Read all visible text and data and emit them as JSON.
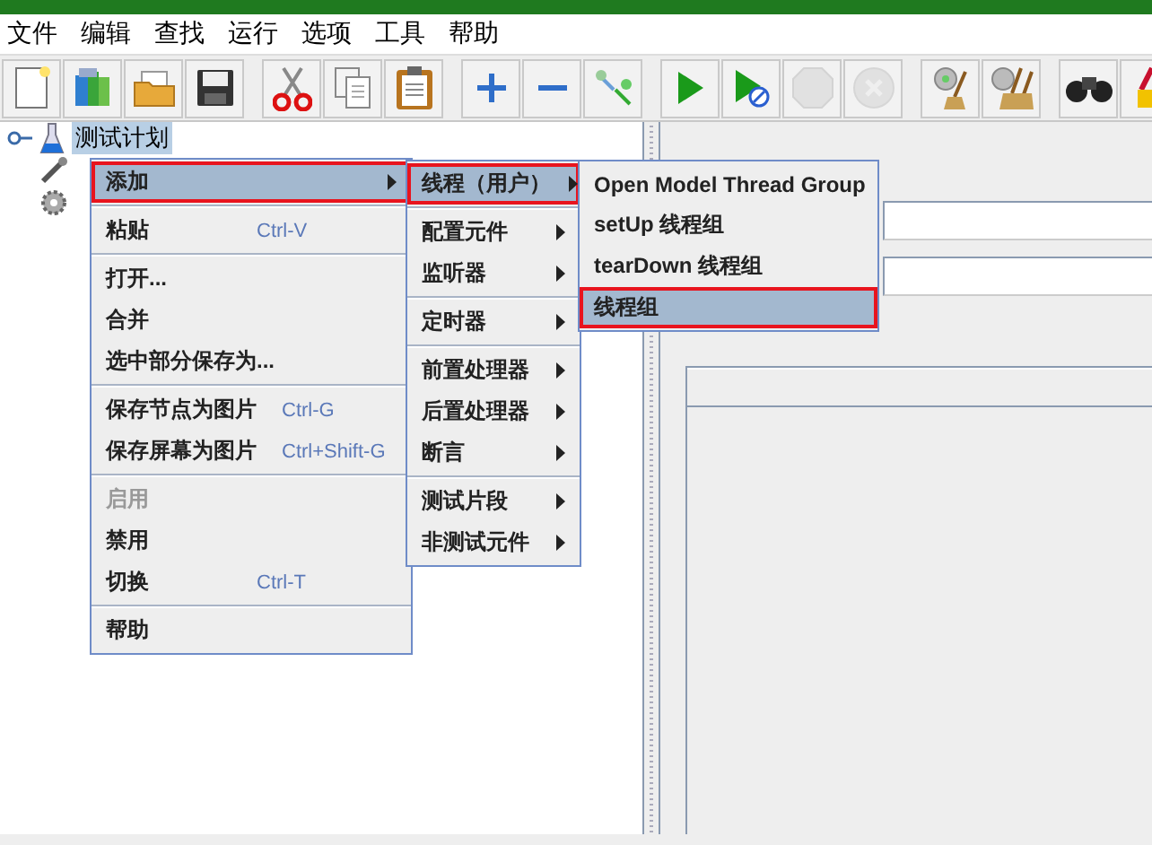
{
  "menubar": [
    "文件",
    "编辑",
    "查找",
    "运行",
    "选项",
    "工具",
    "帮助"
  ],
  "toolbar": [
    {
      "kind": "new",
      "disabled": false
    },
    {
      "kind": "templates",
      "disabled": false
    },
    {
      "kind": "open",
      "disabled": false
    },
    {
      "kind": "save",
      "disabled": false
    },
    {
      "kind": "sep"
    },
    {
      "kind": "cut",
      "disabled": false
    },
    {
      "kind": "copy",
      "disabled": false
    },
    {
      "kind": "paste",
      "disabled": false
    },
    {
      "kind": "sep"
    },
    {
      "kind": "expand",
      "disabled": false
    },
    {
      "kind": "collapse",
      "disabled": false
    },
    {
      "kind": "toggle",
      "disabled": false
    },
    {
      "kind": "sep"
    },
    {
      "kind": "start",
      "disabled": false
    },
    {
      "kind": "start-no-timers",
      "disabled": false
    },
    {
      "kind": "stop",
      "disabled": true
    },
    {
      "kind": "shutdown",
      "disabled": true
    },
    {
      "kind": "sep"
    },
    {
      "kind": "clear",
      "disabled": false
    },
    {
      "kind": "clear-all",
      "disabled": false
    },
    {
      "kind": "sep"
    },
    {
      "kind": "search",
      "disabled": false
    },
    {
      "kind": "broom",
      "disabled": false
    }
  ],
  "tree": {
    "label": "测试计划",
    "selected": true,
    "expanded": true,
    "children": [
      {
        "kind": "tool"
      },
      {
        "kind": "gear"
      }
    ]
  },
  "menus": [
    {
      "items": [
        {
          "kind": "item",
          "label": "添加",
          "submenu": true,
          "selected": true,
          "disabled": false,
          "outlined": true
        },
        {
          "kind": "separator"
        },
        {
          "kind": "item",
          "label": "粘贴",
          "shortcut": "Ctrl-V",
          "submenu": false,
          "selected": false,
          "disabled": false,
          "outlined": false
        },
        {
          "kind": "separator"
        },
        {
          "kind": "item",
          "label": "打开...",
          "submenu": false,
          "selected": false,
          "disabled": false,
          "outlined": false
        },
        {
          "kind": "item",
          "label": "合并",
          "submenu": false,
          "selected": false,
          "disabled": false,
          "outlined": false
        },
        {
          "kind": "item",
          "label": "选中部分保存为...",
          "submenu": false,
          "selected": false,
          "disabled": false,
          "outlined": false
        },
        {
          "kind": "separator"
        },
        {
          "kind": "item",
          "label": "保存节点为图片",
          "shortcut": "Ctrl-G",
          "submenu": false,
          "selected": false,
          "disabled": false,
          "outlined": false
        },
        {
          "kind": "item",
          "label": "保存屏幕为图片",
          "shortcut": "Ctrl+Shift-G",
          "submenu": false,
          "selected": false,
          "disabled": false,
          "outlined": false
        },
        {
          "kind": "separator"
        },
        {
          "kind": "item",
          "label": "启用",
          "submenu": false,
          "selected": false,
          "disabled": true,
          "outlined": false
        },
        {
          "kind": "item",
          "label": "禁用",
          "submenu": false,
          "selected": false,
          "disabled": false,
          "outlined": false
        },
        {
          "kind": "item",
          "label": "切换",
          "shortcut": "Ctrl-T",
          "submenu": false,
          "selected": false,
          "disabled": false,
          "outlined": false
        },
        {
          "kind": "separator"
        },
        {
          "kind": "item",
          "label": "帮助",
          "submenu": false,
          "selected": false,
          "disabled": false,
          "outlined": false
        }
      ]
    },
    {
      "items": [
        {
          "kind": "item",
          "label": "线程（用户）",
          "submenu": true,
          "selected": true,
          "disabled": false,
          "outlined": true
        },
        {
          "kind": "separator"
        },
        {
          "kind": "item",
          "label": "配置元件",
          "submenu": true,
          "selected": false,
          "disabled": false,
          "outlined": false
        },
        {
          "kind": "item",
          "label": "监听器",
          "submenu": true,
          "selected": false,
          "disabled": false,
          "outlined": false
        },
        {
          "kind": "separator"
        },
        {
          "kind": "item",
          "label": "定时器",
          "submenu": true,
          "selected": false,
          "disabled": false,
          "outlined": false
        },
        {
          "kind": "separator"
        },
        {
          "kind": "item",
          "label": "前置处理器",
          "submenu": true,
          "selected": false,
          "disabled": false,
          "outlined": false
        },
        {
          "kind": "item",
          "label": "后置处理器",
          "submenu": true,
          "selected": false,
          "disabled": false,
          "outlined": false
        },
        {
          "kind": "item",
          "label": "断言",
          "submenu": true,
          "selected": false,
          "disabled": false,
          "outlined": false
        },
        {
          "kind": "separator"
        },
        {
          "kind": "item",
          "label": "测试片段",
          "submenu": true,
          "selected": false,
          "disabled": false,
          "outlined": false
        },
        {
          "kind": "item",
          "label": "非测试元件",
          "submenu": true,
          "selected": false,
          "disabled": false,
          "outlined": false
        }
      ]
    },
    {
      "items": [
        {
          "kind": "item",
          "label": "Open Model Thread Group",
          "submenu": false,
          "selected": false,
          "disabled": false,
          "outlined": false
        },
        {
          "kind": "item",
          "label": "setUp 线程组",
          "submenu": false,
          "selected": false,
          "disabled": false,
          "outlined": false
        },
        {
          "kind": "item",
          "label": "tearDown 线程组",
          "submenu": false,
          "selected": false,
          "disabled": false,
          "outlined": false
        },
        {
          "kind": "item",
          "label": "线程组",
          "submenu": false,
          "selected": true,
          "disabled": false,
          "outlined": true
        }
      ]
    }
  ]
}
